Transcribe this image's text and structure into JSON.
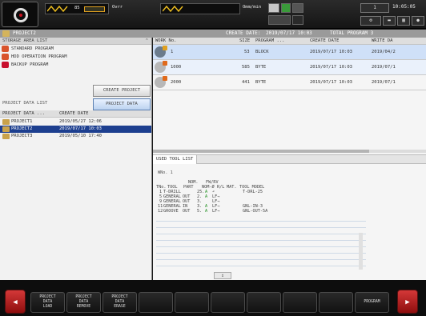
{
  "topbar": {
    "spindle_override": "85",
    "feed_label": "Ovrr",
    "rate_label": "Omm/min",
    "time": "10:05:05",
    "mode_value": "1"
  },
  "title": {
    "project": "PROJECT2",
    "create_date_label": "CREATE DATE:",
    "create_date": "2019/07/17 10:03",
    "total_program_label": "TOTAL PROGRAM 3"
  },
  "storage": {
    "header": "STORAGE AREA LIST",
    "items": [
      {
        "label": "STANDARD PROGRAM",
        "color": "#d9542c"
      },
      {
        "label": "HDD OPERATION PROGRAM",
        "color": "#d9542c"
      },
      {
        "label": "BACKUP PROGRAM",
        "color": "#c8102e"
      }
    ]
  },
  "buttons": {
    "create_project": "CREATE PROJECT",
    "project_data": "PROJECT DATA"
  },
  "project_list": {
    "header": "PROJECT DATA LIST",
    "col_name": "PROJECT DATA ...",
    "col_date": "CREATE DATE",
    "rows": [
      {
        "name": "PROJECT1",
        "date": "2019/05/27 12:06"
      },
      {
        "name": "PROJECT2",
        "date": "2019/07/17 10:03"
      },
      {
        "name": "PROJECT3",
        "date": "2019/05/10 17:40"
      }
    ]
  },
  "work_list": {
    "headers": [
      "WORK No.",
      "SIZE",
      "PROGRAM ...",
      "CREATE DATE",
      "WRITE DA"
    ],
    "rows": [
      {
        "no": "1",
        "size": "53",
        "unit": "BLOCK",
        "create": "2019/07/17 10:03",
        "write": "2019/04/2"
      },
      {
        "no": "1000",
        "size": "585",
        "unit": "BYTE",
        "create": "2019/07/17 10:03",
        "write": "2019/07/1"
      },
      {
        "no": "2000",
        "size": "441",
        "unit": "BYTE",
        "create": "2019/07/17 10:03",
        "write": "2019/07/1"
      }
    ]
  },
  "tool_list": {
    "tab": "USED TOOL LIST",
    "wno_label": "WNo.",
    "wno_value": "1",
    "headers": {
      "tno": "TNo.",
      "tool": "TOOL",
      "part": "PART",
      "nom": "NOM.",
      "nom2": "NOM-Ø",
      "fwrv": "FW/RV",
      "rl": "R/L",
      "mat": "MAT.",
      "model": "TOOL MODEL"
    },
    "rows": [
      {
        "tno": "1",
        "tool": "T-DRILL",
        "part": "",
        "nom": "25.",
        "a": "A",
        "rl": "↶",
        "mat": "",
        "model": "T-DRL-25"
      },
      {
        "tno": "5",
        "tool": "GENERAL",
        "part": "OUT",
        "nom": "2.",
        "a": "A",
        "rl": "LF→",
        "mat": "",
        "model": ""
      },
      {
        "tno": "9",
        "tool": "GENERAL",
        "part": "OUT",
        "nom": "3.",
        "a": "",
        "rl": "LF→",
        "mat": "",
        "model": ""
      },
      {
        "tno": "11",
        "tool": "GENERAL",
        "part": "IN",
        "nom": "3.",
        "a": "A",
        "rl": "LF→",
        "mat": "",
        "model": "GNL-IN-3"
      },
      {
        "tno": "12",
        "tool": "GROOVE",
        "part": "OUT",
        "nom": "5.",
        "a": "A",
        "rl": "LF→",
        "mat": "",
        "model": "GNL-OUT-5A"
      }
    ]
  },
  "softkeys": [
    {
      "l1": "PROJECT",
      "l2": "DATA",
      "l3": "LOAD"
    },
    {
      "l1": "PROJECT",
      "l2": "DATA",
      "l3": "REMOVE"
    },
    {
      "l1": "PROJECT",
      "l2": "DATA",
      "l3": "ERASE"
    },
    {
      "l1": "",
      "l2": "",
      "l3": ""
    },
    {
      "l1": "",
      "l2": "",
      "l3": ""
    },
    {
      "l1": "",
      "l2": "",
      "l3": ""
    },
    {
      "l1": "",
      "l2": "",
      "l3": ""
    },
    {
      "l1": "",
      "l2": "",
      "l3": ""
    },
    {
      "l1": "PROGRAM",
      "l2": "",
      "l3": ""
    }
  ]
}
